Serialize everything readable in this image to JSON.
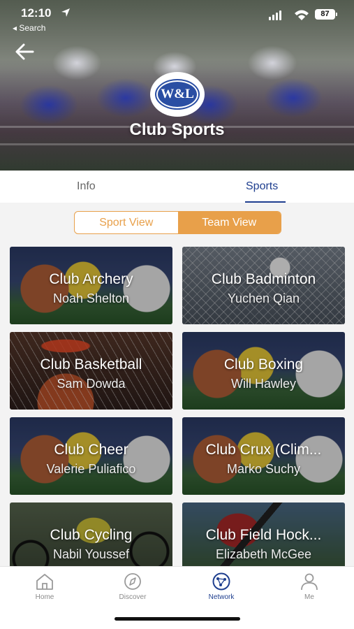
{
  "status_bar": {
    "time": "12:10",
    "back_label": "◂ Search",
    "battery": "87"
  },
  "header": {
    "logo_text": "W&L",
    "title": "Club Sports"
  },
  "tabs": [
    {
      "label": "Info",
      "active": false
    },
    {
      "label": "Sports",
      "active": true
    }
  ],
  "view_toggle": {
    "options": [
      "Sport View",
      "Team View"
    ],
    "selected": "Team View"
  },
  "teams": [
    {
      "name": "Club Archery",
      "leader": "Noah Shelton"
    },
    {
      "name": "Club Badminton",
      "leader": "Yuchen Qian"
    },
    {
      "name": "Club Basketball",
      "leader": "Sam Dowda"
    },
    {
      "name": "Club Boxing",
      "leader": "Will Hawley"
    },
    {
      "name": "Club Cheer",
      "leader": "Valerie Puliafico"
    },
    {
      "name": "Club Crux (Clim...",
      "leader": "Marko Suchy"
    },
    {
      "name": "Club Cycling",
      "leader": "Nabil Youssef"
    },
    {
      "name": "Club Field Hock...",
      "leader": "Elizabeth McGee"
    }
  ],
  "bottom_nav": [
    {
      "label": "Home",
      "icon": "home-icon"
    },
    {
      "label": "Discover",
      "icon": "compass-icon"
    },
    {
      "label": "Network",
      "icon": "network-icon",
      "active": true
    },
    {
      "label": "Me",
      "icon": "person-icon"
    }
  ],
  "colors": {
    "accent": "#e8a04a",
    "brand": "#1f3f8f"
  }
}
